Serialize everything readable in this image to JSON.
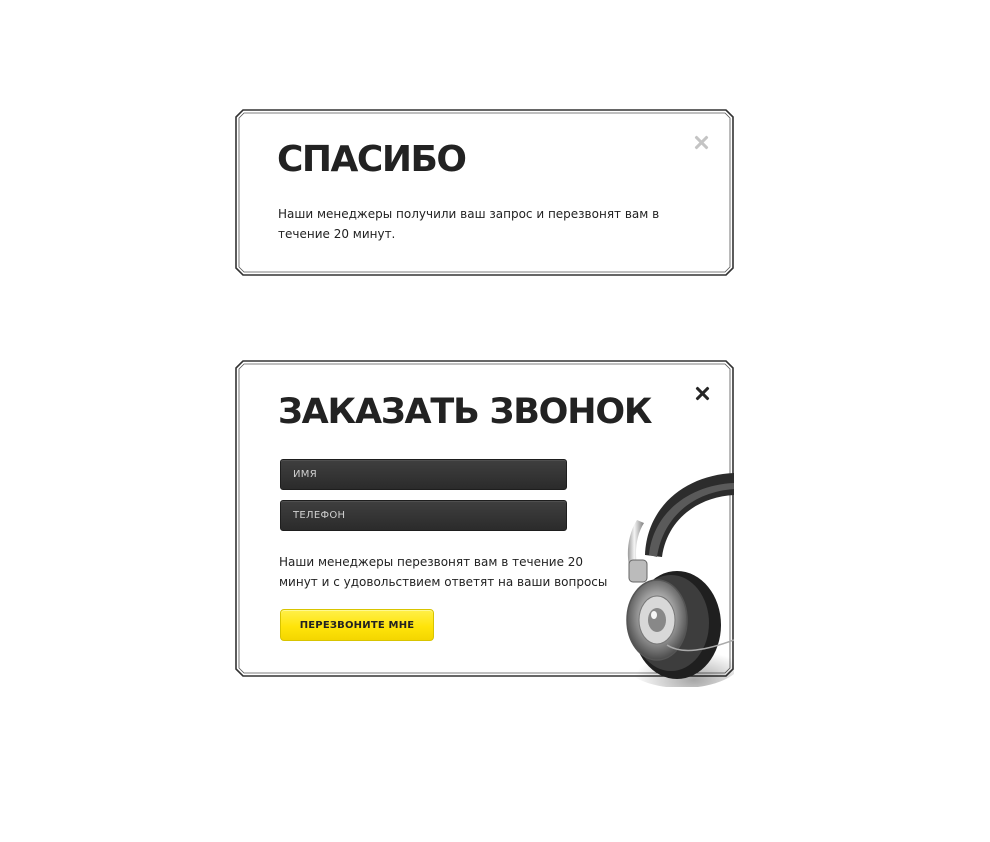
{
  "thanks_modal": {
    "title": "СПАСИБО",
    "message": "Наши менеджеры получили ваш запрос и перезвонят вам в течение 20 минут."
  },
  "callback_modal": {
    "title": "ЗАКАЗАТЬ ЗВОНОК",
    "name_placeholder": "ИМЯ",
    "phone_placeholder": "ТЕЛЕФОН",
    "message": "Наши менеджеры перезвонят вам в течение 20 минут и с удовольствием ответят на ваши вопросы",
    "submit_label": "ПЕРЕЗВОНИТЕ МНЕ"
  },
  "icons": {
    "close": "close-icon",
    "illustration": "headphones-icon"
  },
  "colors": {
    "accent_yellow": "#ffe40a",
    "field_dark": "#333333",
    "text": "#222222"
  }
}
